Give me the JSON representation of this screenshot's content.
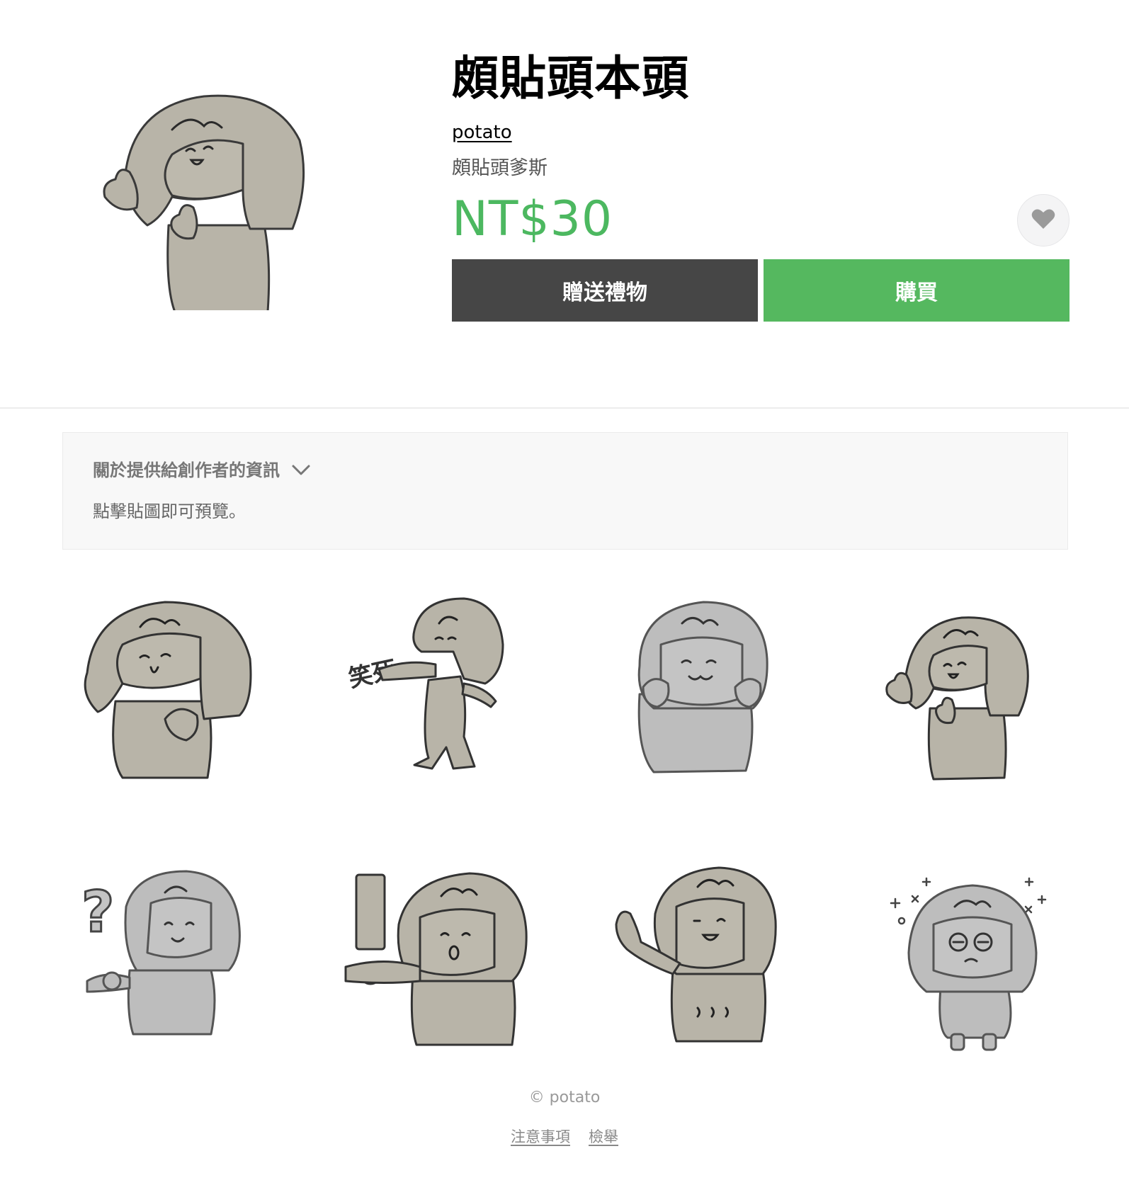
{
  "product": {
    "title": "頗貼頭本頭",
    "author": "potato",
    "subtitle": "頗貼頭爹斯",
    "price": "NT$30"
  },
  "actions": {
    "gift_label": "贈送禮物",
    "buy_label": "購買",
    "favorite_icon": "heart-icon"
  },
  "creator_info": {
    "toggle_label": "關於提供給創作者的資訊",
    "toggle_icon": "chevron-down-icon",
    "preview_hint": "點擊貼圖即可預覽。"
  },
  "stickers": [
    {
      "pose": "hand-on-chest"
    },
    {
      "pose": "pointing",
      "caption": "笑死"
    },
    {
      "pose": "fists-on-cheeks"
    },
    {
      "pose": "thumbs-up"
    },
    {
      "pose": "question",
      "caption": "?"
    },
    {
      "pose": "exclamation",
      "caption": "!"
    },
    {
      "pose": "waving"
    },
    {
      "pose": "sparkles"
    }
  ],
  "footer": {
    "copyright": "© potato",
    "links": [
      "注意事項",
      "檢舉"
    ]
  },
  "colors": {
    "price": "#4cb860",
    "buy_button": "#55b85f",
    "gift_button": "#464646",
    "sticker_tan": "#b7b4a8",
    "sticker_gray": "#bdbdbd"
  }
}
